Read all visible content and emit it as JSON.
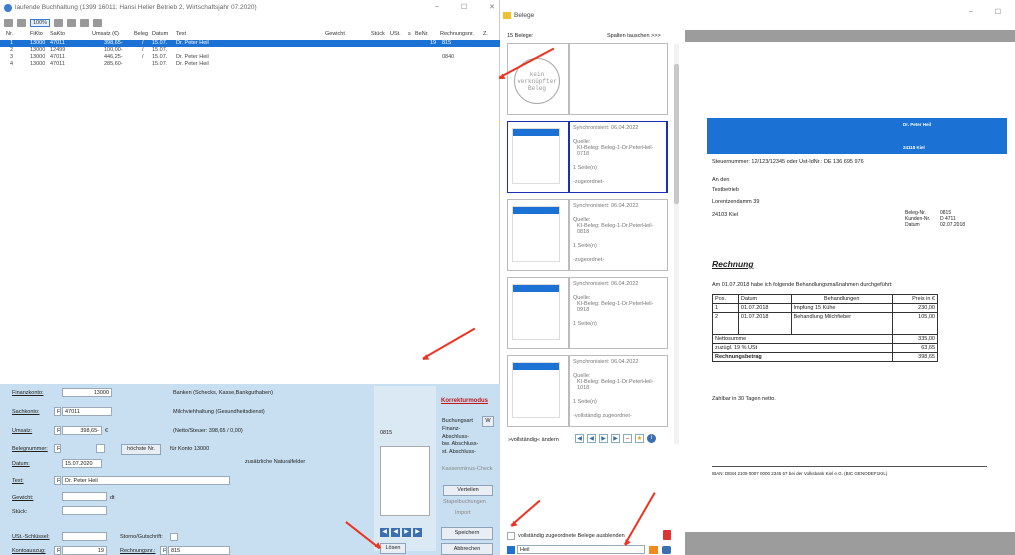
{
  "app": {
    "title": "laufende Buchhaltung (1399 16011: Hansi Heller Betrieb 2, Wirtschaftsjahr 07.2020)",
    "zoom": "100%",
    "min": "–",
    "max": "☐",
    "close": "✕"
  },
  "table": {
    "headers": [
      "Nr.",
      "FiKto",
      "SaKto",
      "Umsatz (€)",
      "Beleg",
      "Datum",
      "Text",
      "Gewicht",
      "Stück",
      "USt.",
      "s",
      "BeNr.",
      "Rechnungsnr.",
      "Z."
    ],
    "rows": [
      {
        "nr": "1",
        "fikto": "13000",
        "sakto": "47011",
        "umsatz": "398,65-",
        "beleg": "/",
        "datum": "15.07.",
        "text": "Dr. Peter Heil",
        "ust": "19",
        "renr": "815"
      },
      {
        "nr": "2",
        "fikto": "13000",
        "sakto": "12499",
        "umsatz": "100,00-",
        "beleg": "/",
        "datum": "15.07.",
        "text": "",
        "ust": "",
        "renr": ""
      },
      {
        "nr": "3",
        "fikto": "13000",
        "sakto": "47011",
        "umsatz": "446,25-",
        "beleg": "/",
        "datum": "15.07.",
        "text": "Dr. Peter Heil",
        "ust": "",
        "renr": "0840"
      },
      {
        "nr": "4",
        "fikto": "13000",
        "sakto": "47011",
        "umsatz": "285,60-",
        "beleg": "",
        "datum": "15.07.",
        "text": "Dr. Peter Heil",
        "ust": "",
        "renr": ""
      }
    ]
  },
  "form": {
    "finanzkonto_label": "Finanzkonto:",
    "finanzkonto_value": "13000",
    "finanzkonto_desc": "Banken (Schecks, Kasse,Bankguthaben)",
    "sachkonto_label": "Sachkonto:",
    "sachkonto_prefix": "F",
    "sachkonto_value": "47011",
    "sachkonto_desc": "Milchviehhaltung (Gesundheitsdienst)",
    "umsatz_label": "Umsatz:",
    "umsatz_prefix": "F",
    "umsatz_value": "398,65-",
    "umsatz_unit": "€",
    "umsatz_desc": "(Netto/Steuer: 398,65 / 0,00)",
    "belegnummer_label": "Belegnummer:",
    "belegnummer_prefix": "F",
    "hoechste_nr": "höchste Nr.",
    "fuer_konto": "für Konto 13000",
    "datum_label": "Datum:",
    "datum_value": "15.07.2020",
    "naturalfelder": "zusätzliche Naturalfelder",
    "text_label": "Text:",
    "text_prefix": "F",
    "text_value": "Dr. Peter Heil",
    "gewicht_label": "Gewicht:",
    "gewicht_unit": "dt",
    "stueck_label": "Stück:",
    "ust_label": "USt.-Schlüssel:",
    "storno_label": "Storno/Gutschrift:",
    "kontoauszug_label": "Kontoauszug:",
    "kontoauszug_prefix": "F",
    "kontoauszug_value": "19",
    "rechnungsnr_label": "Rechnungsnr.:",
    "rechnungsnr_prefix": "F",
    "rechnungsnr_value": "815",
    "beleg_ref": "0815",
    "loesen": "Lösen"
  },
  "side": {
    "korrekturmodus": "Korrekturmodus",
    "buchungsart": "Buchungsart",
    "buchungsart_key": "W",
    "options": [
      "Finanz-",
      "Abschluss-",
      "bw. Abschluss-",
      "st. Abschluss-"
    ],
    "kassenminus": "Kassenminus-Check",
    "verteilen": "Verteilen",
    "stapelbuchungen": "Stapelbuchungen",
    "import": "Import",
    "speichern": "Speichern",
    "abbrechen": "Abbrechen"
  },
  "belege": {
    "title": "Belege",
    "count": "15 Belege:",
    "spalten": "Spalten tauschen >>>",
    "kein": "kein verknüpfter Beleg",
    "items": [
      {
        "sync": "Synchronisiert: 06.04.2022",
        "quelle": "Quelle:",
        "name": "KI-Beleg: Beleg-1-Dr.PeterHeil-0718",
        "seiten": "1 Seite(n)",
        "status": "-zugeordnet-"
      },
      {
        "sync": "Synchronisiert: 06.04.2022",
        "quelle": "Quelle:",
        "name": "KI-Beleg: Beleg-1-Dr.PeterHeil-0818",
        "seiten": "1 Seite(n)",
        "status": "-zugeordnet-"
      },
      {
        "sync": "Synchronisiert: 06.04.2022",
        "quelle": "Quelle:",
        "name": "KI-Beleg: Beleg-1-Dr.PeterHeil-0918",
        "seiten": "1 Seite(n)",
        "status": ""
      },
      {
        "sync": "Synchronisiert: 06.04.2022",
        "quelle": "Quelle:",
        "name": "KI-Beleg: Beleg-1-Dr.PeterHeil-1018",
        "seiten": "1 Seite(n)",
        "status": "-vollständig zugeordnet-"
      }
    ],
    "aendern": "»vollständig« ändern",
    "ausblenden": "vollständig zugeordnete Belege ausblenden",
    "search": "Heil"
  },
  "invoice": {
    "doctor": "Dr. Peter Heil",
    "ort": "24118 Kiel",
    "steuer": "Steuernummer: 12/123/12345 oder Ust-IdNr.: DE 136 695 976",
    "an": "An den",
    "empfaenger": "Testbetrieb",
    "strasse": "Lorentzendamm 39",
    "stadt": "24103 Kiel",
    "belegnr_label": "Beleg-Nr.",
    "belegnr": "0815",
    "kundennr_label": "Kunden-Nr.",
    "kundennr": "D 4711",
    "datum_label": "Datum",
    "datum": "02.07.2018",
    "heading": "Rechnung",
    "intro": "Am 01.07.2018 habe ich folgende Behandlungsmaßnahmen durchgeführt:",
    "cols": [
      "Pos.",
      "Datum",
      "Behandlungen",
      "Preis in €"
    ],
    "lines": [
      {
        "pos": "1",
        "datum": "01.07.2018",
        "beh": "Impfung  15 Kühe",
        "preis": "230,00"
      },
      {
        "pos": "2",
        "datum": "01.07.2018",
        "beh": "Behandlung Milchfieber",
        "preis": "105,00"
      }
    ],
    "netto_label": "Nettosumme",
    "netto": "335,00",
    "ust_label": "zuzügl. 19 % USt",
    "ust": "63,65",
    "brutto_label": "Rechnungsbetrag",
    "brutto": "398,65",
    "zahlung": "Zahlbar in 30 Tagen netto.",
    "iban": "IBAN: DE84 2109 0007 0000 2345 67 bei der Volksbank Kiel e.G. (BIC GENODEF1KIL)"
  }
}
